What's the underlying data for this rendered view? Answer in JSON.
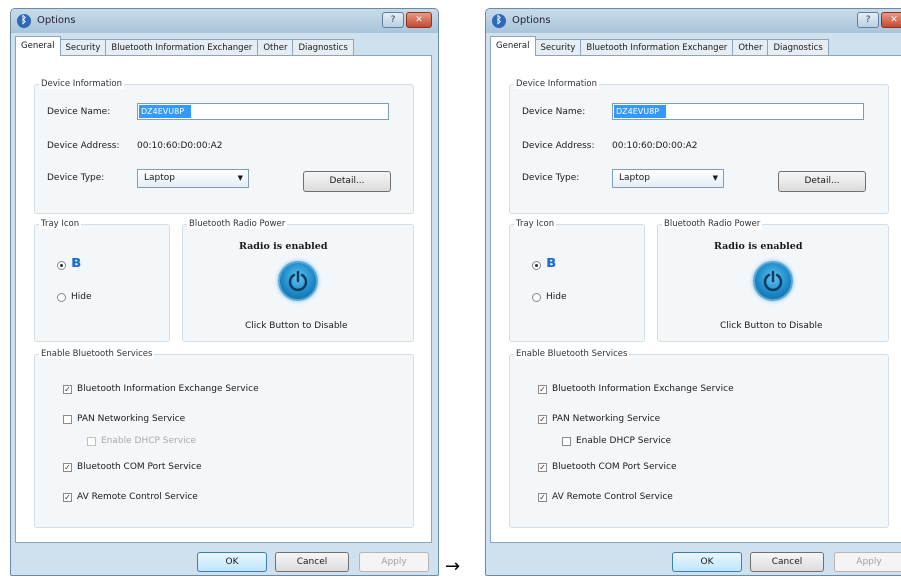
{
  "arrow": "→",
  "windows": [
    {
      "title": "Options",
      "tabs": [
        "General",
        "Security",
        "Bluetooth Information Exchanger",
        "Other",
        "Diagnostics"
      ],
      "device_info": {
        "group_label": "Device Information",
        "name_label": "Device Name:",
        "name_value": "DZ4EVU8P",
        "address_label": "Device Address:",
        "address_value": "00:10:60:D0:00:A2",
        "type_label": "Device Type:",
        "type_value": "Laptop",
        "detail_button": "Detail..."
      },
      "tray": {
        "group_label": "Tray Icon",
        "hide_label": "Hide"
      },
      "radio_power": {
        "group_label": "Bluetooth Radio Power",
        "status": "Radio is enabled",
        "caption": "Click Button to Disable"
      },
      "services": {
        "group_label": "Enable Bluetooth Services",
        "items": [
          {
            "label": "Bluetooth Information Exchange Service",
            "checked": true,
            "enabled": true
          },
          {
            "label": "PAN Networking Service",
            "checked": false,
            "enabled": true
          },
          {
            "label": "Enable DHCP Service",
            "checked": false,
            "enabled": false
          },
          {
            "label": "Bluetooth COM Port Service",
            "checked": true,
            "enabled": true
          },
          {
            "label": "AV Remote Control Service",
            "checked": true,
            "enabled": true
          }
        ]
      },
      "buttons": {
        "ok": "OK",
        "cancel": "Cancel",
        "apply": "Apply"
      }
    },
    {
      "title": "Options",
      "tabs": [
        "General",
        "Security",
        "Bluetooth Information Exchanger",
        "Other",
        "Diagnostics"
      ],
      "device_info": {
        "group_label": "Device Information",
        "name_label": "Device Name:",
        "name_value": "DZ4EVU8P",
        "address_label": "Device Address:",
        "address_value": "00:10:60:D0:00:A2",
        "type_label": "Device Type:",
        "type_value": "Laptop",
        "detail_button": "Detail..."
      },
      "tray": {
        "group_label": "Tray Icon",
        "hide_label": "Hide"
      },
      "radio_power": {
        "group_label": "Bluetooth Radio Power",
        "status": "Radio is enabled",
        "caption": "Click Button to Disable"
      },
      "services": {
        "group_label": "Enable Bluetooth Services",
        "items": [
          {
            "label": "Bluetooth Information Exchange Service",
            "checked": true,
            "enabled": true
          },
          {
            "label": "PAN Networking Service",
            "checked": true,
            "enabled": true
          },
          {
            "label": "Enable DHCP Service",
            "checked": false,
            "enabled": true
          },
          {
            "label": "Bluetooth COM Port Service",
            "checked": true,
            "enabled": true
          },
          {
            "label": "AV Remote Control Service",
            "checked": true,
            "enabled": true
          }
        ]
      },
      "buttons": {
        "ok": "OK",
        "cancel": "Cancel",
        "apply": "Apply"
      }
    }
  ]
}
